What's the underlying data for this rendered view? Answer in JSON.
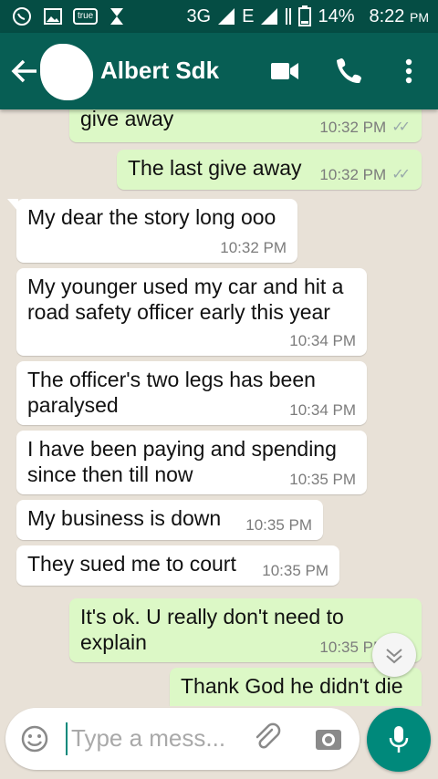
{
  "status_bar": {
    "network": "3G",
    "network2": "E",
    "battery": "14%",
    "time": "8:22",
    "ampm": "PM",
    "badge": "true"
  },
  "header": {
    "contact_name": "Albert Sdk",
    "icons": [
      "back-arrow-icon",
      "video-call-icon",
      "phone-icon",
      "more-vert-icon"
    ]
  },
  "messages": [
    {
      "direction": "out",
      "text": "give away",
      "time": "10:32 PM",
      "ticks": "✓✓"
    },
    {
      "direction": "out",
      "text": "The last give away",
      "time": "10:32 PM",
      "ticks": "✓✓"
    },
    {
      "direction": "in",
      "text": "My dear the story long ooo",
      "time": "10:32 PM"
    },
    {
      "direction": "in",
      "text_lines": [
        "My younger used my car and hit a",
        "road safety officer early this year"
      ],
      "time": "10:34 PM"
    },
    {
      "direction": "in",
      "text_lines": [
        "The officer's two legs has been",
        "paralysed"
      ],
      "time": "10:34 PM"
    },
    {
      "direction": "in",
      "text_lines": [
        "I have been paying and spending",
        "since then till now"
      ],
      "time": "10:35 PM"
    },
    {
      "direction": "in",
      "text": "My business is down",
      "time": "10:35 PM"
    },
    {
      "direction": "in",
      "text": "They sued me to court",
      "time": "10:35 PM"
    },
    {
      "direction": "out",
      "text_lines": [
        "It's ok. U really don't need to",
        "explain"
      ],
      "time": "10:35 PM",
      "ticks": "✓✓"
    },
    {
      "direction": "out",
      "text": "Thank God he didn't die",
      "time": ""
    }
  ],
  "composer": {
    "placeholder": "Type a mess..."
  },
  "colors": {
    "toolbar": "#075e54",
    "status_bar": "#054d44",
    "outgoing_bubble": "#dcf8c6",
    "incoming_bubble": "#ffffff",
    "accent": "#00897b"
  }
}
